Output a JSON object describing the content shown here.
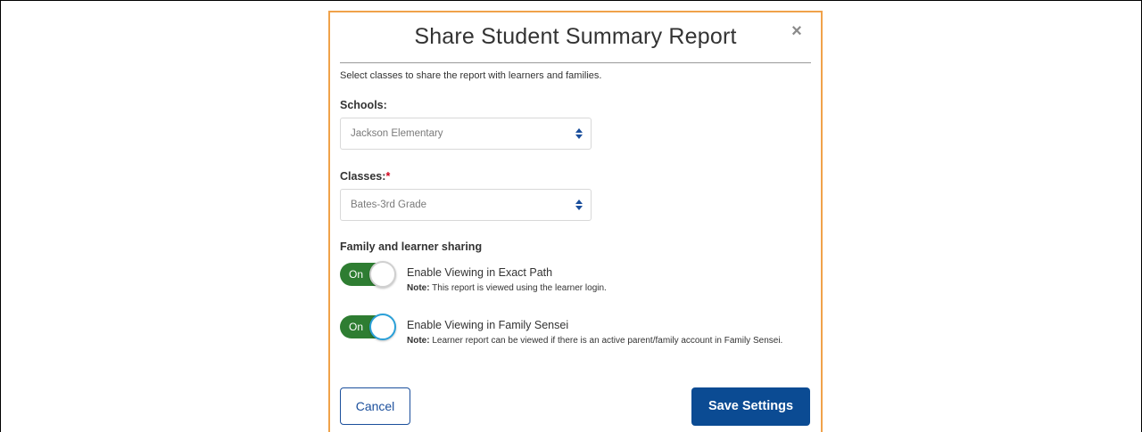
{
  "modal": {
    "title": "Share Student Summary Report",
    "close_icon": "×",
    "intro": "Select classes to share the report with learners and families."
  },
  "schools": {
    "label": "Schools:",
    "selected": "Jackson Elementary"
  },
  "classes": {
    "label": "Classes:",
    "required_mark": "*",
    "selected": "Bates-3rd Grade"
  },
  "sharing": {
    "title": "Family and learner sharing",
    "toggles": [
      {
        "state_label": "On",
        "title": "Enable Viewing in Exact Path",
        "note_label": "Note:",
        "note_text": " This report is viewed using the learner login."
      },
      {
        "state_label": "On",
        "title": "Enable Viewing in Family Sensei",
        "note_label": "Note:",
        "note_text": " Learner report can be viewed if there is an active parent/family account in Family Sensei."
      }
    ]
  },
  "footer": {
    "cancel_label": "Cancel",
    "save_label": "Save Settings"
  },
  "colors": {
    "modal_border": "#f0a24a",
    "toggle_on": "#2e7d32",
    "primary": "#0b4b93",
    "required": "#d0021b",
    "select_arrows": "#1b4f9c"
  },
  "icons": {
    "close": "close-icon",
    "select_arrows": "sort-arrows-icon"
  }
}
